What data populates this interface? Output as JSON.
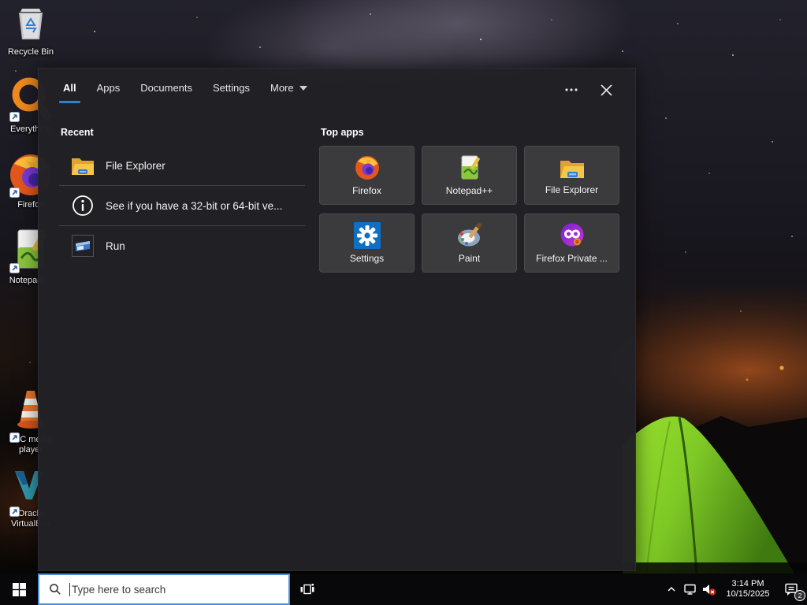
{
  "colors": {
    "accent_blue": "#2f7fd4",
    "panel_bg": "#222226",
    "tile_bg": "#3b3a3d",
    "taskbar_bg": "#08080a",
    "mute_red": "#c42b1c",
    "tent_green": "#7fc926",
    "search_box_bg": "#ffffff"
  },
  "search_panel": {
    "tabs": [
      {
        "label": "All",
        "active": true
      },
      {
        "label": "Apps",
        "active": false
      },
      {
        "label": "Documents",
        "active": false
      },
      {
        "label": "Settings",
        "active": false
      },
      {
        "label": "More",
        "active": false,
        "has_dropdown": true
      }
    ],
    "window_controls": {
      "ellipsis_icon": "⋯",
      "close_icon": "✕"
    },
    "recent": {
      "header": "Recent",
      "items": [
        {
          "icon": "folder-icon",
          "label": "File Explorer"
        },
        {
          "icon": "info-icon",
          "label": "See if you have a 32-bit or 64-bit ve..."
        },
        {
          "icon": "run-icon",
          "label": "Run"
        }
      ]
    },
    "top_apps": {
      "header": "Top apps",
      "items": [
        {
          "icon": "firefox-icon",
          "label": "Firefox"
        },
        {
          "icon": "notepad-plus-plus-icon",
          "label": "Notepad++"
        },
        {
          "icon": "file-explorer-icon",
          "label": "File Explorer"
        },
        {
          "icon": "settings-gear-icon",
          "label": "Settings"
        },
        {
          "icon": "paint-icon",
          "label": "Paint"
        },
        {
          "icon": "firefox-private-icon",
          "label": "Firefox Private ..."
        }
      ]
    }
  },
  "desktop": {
    "icons": [
      {
        "icon": "recycle-bin-icon",
        "label": "Recycle Bin"
      },
      {
        "icon": "everything-icon",
        "label": "Everything"
      },
      {
        "icon": "firefox-icon",
        "label": "Firefox"
      },
      {
        "icon": "notepad-plus-plus-icon",
        "label": "Notepad++"
      },
      {
        "icon": "vlc-icon",
        "label": "VLC media player"
      },
      {
        "icon": "virtualbox-icon",
        "label": "Oracle VirtualBox"
      }
    ]
  },
  "taskbar": {
    "search": {
      "placeholder": "Type here to search"
    },
    "tray": {
      "time": "3:14 PM",
      "date": "10/15/2025",
      "notification_count": "2"
    }
  }
}
